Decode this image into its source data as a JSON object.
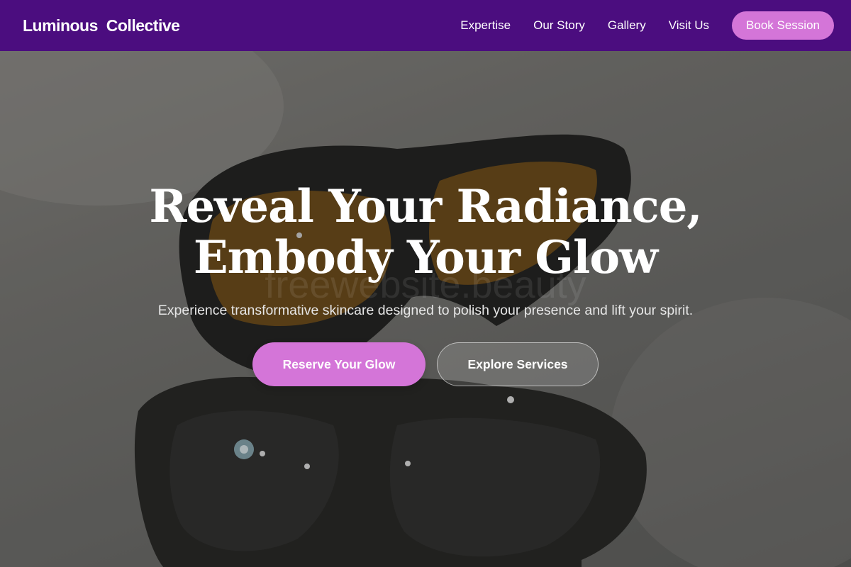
{
  "brand": {
    "name": "Luminous  Collective"
  },
  "nav": {
    "links": [
      {
        "label": "Expertise"
      },
      {
        "label": "Our Story"
      },
      {
        "label": "Gallery"
      },
      {
        "label": "Visit Us"
      }
    ],
    "cta_label": "Book Session"
  },
  "hero": {
    "headline_line1": "Reveal Your Radiance,",
    "headline_line2": "Embody Your Glow",
    "watermark": "freewebsite.beauty",
    "subtitle": "Experience transformative skincare designed to polish your presence and lift your spirit.",
    "primary_cta": "Reserve Your Glow",
    "secondary_cta": "Explore Services",
    "background_image": "two pairs of dark protective goggles with amber lenses on a light surface"
  },
  "colors": {
    "nav_background": "#4b0d7f",
    "accent": "#d475d8",
    "text": "#ffffff"
  }
}
